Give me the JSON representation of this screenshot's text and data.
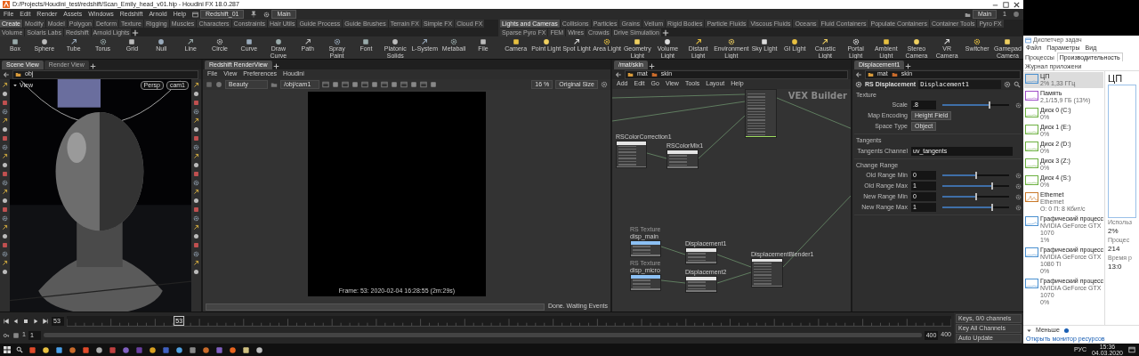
{
  "title_bar": {
    "title": "D:/Projects/Houdini_test/redshift/Scan_Emily_head_v01.hip - Houdini FX 18.0.287"
  },
  "menu_bar": {
    "menus": [
      "File",
      "Edit",
      "Render",
      "Assets",
      "Windows",
      "Redshift",
      "Arnold",
      "Help"
    ],
    "desktop": "Redshift_01",
    "network": "Main",
    "context": "Main",
    "context_count": "1"
  },
  "shelf": {
    "left_tabs": [
      {
        "label": "Create",
        "selected": true
      },
      {
        "label": "Modify",
        "selected": false
      },
      {
        "label": "Model",
        "selected": false
      },
      {
        "label": "Polygon",
        "selected": false
      },
      {
        "label": "Deform",
        "selected": false
      },
      {
        "label": "Texture",
        "selected": false
      },
      {
        "label": "Rigging",
        "selected": false
      },
      {
        "label": "Muscles",
        "selected": false
      },
      {
        "label": "Characters",
        "selected": false
      },
      {
        "label": "Constraints",
        "selected": false
      },
      {
        "label": "Hair Utils",
        "selected": false
      },
      {
        "label": "Guide Process",
        "selected": false
      },
      {
        "label": "Guide Brushes",
        "selected": false
      },
      {
        "label": "Terrain FX",
        "selected": false
      },
      {
        "label": "Simple FX",
        "selected": false
      },
      {
        "label": "Cloud FX",
        "selected": false
      },
      {
        "label": "Volume",
        "selected": false
      },
      {
        "label": "Solaris Labs",
        "selected": false
      },
      {
        "label": "Redshift",
        "selected": false
      },
      {
        "label": "Arnold Lights",
        "selected": false
      }
    ],
    "right_tabs": [
      {
        "label": "Lights and Cameras",
        "selected": true
      },
      {
        "label": "Collisions",
        "selected": false
      },
      {
        "label": "Particles",
        "selected": false
      },
      {
        "label": "Grains",
        "selected": false
      },
      {
        "label": "Vellum",
        "selected": false
      },
      {
        "label": "Rigid Bodies",
        "selected": false
      },
      {
        "label": "Particle Fluids",
        "selected": false
      },
      {
        "label": "Viscous Fluids",
        "selected": false
      },
      {
        "label": "Oceans",
        "selected": false
      },
      {
        "label": "Fluid Containers",
        "selected": false
      },
      {
        "label": "Populate Containers",
        "selected": false
      },
      {
        "label": "Container Tools",
        "selected": false
      },
      {
        "label": "Pyro FX",
        "selected": false
      },
      {
        "label": "Sparse Pyro FX",
        "selected": false
      },
      {
        "label": "FEM",
        "selected": false
      },
      {
        "label": "Wires",
        "selected": false
      },
      {
        "label": "Crowds",
        "selected": false
      },
      {
        "label": "Drive Simulation",
        "selected": false
      }
    ],
    "left_tools": [
      "Box",
      "Sphere",
      "Tube",
      "Torus",
      "Grid",
      "Null",
      "Line",
      "Circle",
      "Curve",
      "Draw Curve",
      "Path",
      "Spray Paint",
      "Font",
      "Platonic Solids",
      "L-System",
      "Metaball",
      "File"
    ],
    "right_tools": [
      "Camera",
      "Point Light",
      "Spot Light",
      "Area Light",
      "Geometry Light",
      "Volume Light",
      "Distant Light",
      "Environment Light",
      "Sky Light",
      "GI Light",
      "Caustic Light",
      "Portal Light",
      "Ambient Light",
      "Stereo Camera",
      "VR Camera",
      "Switcher",
      "Gamepad Camera"
    ]
  },
  "scene_pane": {
    "tabs": [
      {
        "label": "Scene View",
        "selected": true
      },
      {
        "label": "Render View",
        "selected": false
      }
    ],
    "path": "obj",
    "viewport": {
      "title": "View",
      "projection": "Persp",
      "camera": "cam1"
    }
  },
  "render_pane": {
    "tab": "Redshift RenderView",
    "menus": [
      "File",
      "View",
      "Preferences",
      "Houdini"
    ],
    "aov": "Beauty",
    "camera": "/obj/cam1",
    "zoom": "16 %",
    "size": "Original Size",
    "frame_info": "Frame: 53: 2020-02-04 16:28:55 (2m:29s)",
    "status": "Done. Waiting Events"
  },
  "network_pane": {
    "tab": "/mat/skin",
    "path": [
      "mat",
      "skin"
    ],
    "menus": [
      "Add",
      "Edit",
      "Go",
      "View",
      "Tools",
      "Layout",
      "Help"
    ],
    "context_label": "VEX Builder",
    "nodes": [
      {
        "kind": "material"
      },
      {
        "kind": "utility",
        "name": "RSColorCorrection1"
      },
      {
        "kind": "utility",
        "name": "RSColorMix1"
      },
      {
        "kind": "texture",
        "type": "RS Texture",
        "name": "disp_main"
      },
      {
        "kind": "texture",
        "type": "RS Texture",
        "name": "disp_micro"
      },
      {
        "kind": "utility",
        "name": "Displacement1"
      },
      {
        "kind": "utility",
        "name": "Displacement2"
      },
      {
        "kind": "utility",
        "name": "DisplacementBlender1"
      }
    ]
  },
  "parameter_pane": {
    "tab": "Displacement1",
    "path": [
      "mat",
      "skin"
    ],
    "node_type": "RS Displacement",
    "node_name": "Displacement1",
    "sections": [
      {
        "title": "Texture",
        "params": [
          {
            "kind": "slider",
            "label": "Scale",
            "value": ".8",
            "level": 0.7
          },
          {
            "kind": "menu",
            "label": "Map Encoding",
            "value": "Height Field"
          },
          {
            "kind": "menu",
            "label": "Space Type",
            "value": "Object"
          }
        ]
      },
      {
        "title": "Tangents",
        "params": [
          {
            "kind": "text",
            "label": "Tangents Channel",
            "value": "uv_tangents"
          }
        ]
      },
      {
        "title": "Change Range",
        "params": [
          {
            "kind": "slider",
            "label": "Old Range Min",
            "value": "0",
            "level": 0.5
          },
          {
            "kind": "slider",
            "label": "Old Range Max",
            "value": "1",
            "level": 0.75
          },
          {
            "kind": "slider",
            "label": "New Range Min",
            "value": "0",
            "level": 0.5
          },
          {
            "kind": "slider",
            "label": "New Range Max",
            "value": "1",
            "level": 0.75
          }
        ]
      }
    ]
  },
  "timeline": {
    "frame": "53",
    "playhead": {
      "label": "53",
      "level": 0.127
    },
    "start": "1",
    "range_start": "1",
    "range_end": "400",
    "end": "400",
    "keys": "Keys, 0/0 channels",
    "key_all": "Key All Channels",
    "update": "Auto Update"
  },
  "task_manager": {
    "title": "Диспетчер задач",
    "menus": [
      "Файл",
      "Параметры",
      "Вид"
    ],
    "tabs": [
      {
        "label": "Процессы",
        "selected": false
      },
      {
        "label": "Производительность",
        "selected": true
      },
      {
        "label": "Журнал приложени",
        "selected": false
      }
    ],
    "items": [
      {
        "name": "ЦП",
        "details": [
          "2% 1,33 ГГц"
        ],
        "color": "#4a90d0",
        "selected": true
      },
      {
        "name": "Память",
        "details": [
          "2,1/15,9 ГБ (13%)"
        ],
        "color": "#a050c8",
        "selected": false
      },
      {
        "name": "Диск 0 (C:)",
        "details": [
          "0%"
        ],
        "color": "#6cb040",
        "selected": false
      },
      {
        "name": "Диск 1 (E:)",
        "details": [
          "0%"
        ],
        "color": "#6cb040",
        "selected": false
      },
      {
        "name": "Диск 2 (D:)",
        "details": [
          "0%"
        ],
        "color": "#6cb040",
        "selected": false
      },
      {
        "name": "Диск 3 (Z:)",
        "details": [
          "0%"
        ],
        "color": "#6cb040",
        "selected": false
      },
      {
        "name": "Диск 4 (S:)",
        "details": [
          "0%"
        ],
        "color": "#6cb040",
        "selected": false
      },
      {
        "name": "Ethernet",
        "details": [
          "Ethernet",
          "О: 0 П: 8 Кбит/с"
        ],
        "color": "#c87828",
        "selected": false
      },
      {
        "name": "Графический процесс",
        "details": [
          "NVIDIA GeForce GTX 1070",
          "1%"
        ],
        "color": "#4a90d0",
        "selected": false
      },
      {
        "name": "Графический процесс",
        "details": [
          "NVIDIA GeForce GTX 1080 Ti",
          "0%"
        ],
        "color": "#4a90d0",
        "selected": false
      },
      {
        "name": "Графический процесс",
        "details": [
          "NVIDIA GeForce GTX 1070",
          "0%"
        ],
        "color": "#4a90d0",
        "selected": false
      }
    ],
    "detail_title": "ЦП",
    "stats": [
      {
        "caption": "Использ",
        "value": "2%"
      },
      {
        "caption": "Процес",
        "value": "214"
      },
      {
        "caption": "Время р",
        "value": "13:0"
      }
    ],
    "fewer": "Меньше",
    "monitor": "Открыть монитор ресурсов"
  },
  "taskbar": {
    "language": "РУС",
    "time": "15:36",
    "date": "04.03.2020"
  }
}
